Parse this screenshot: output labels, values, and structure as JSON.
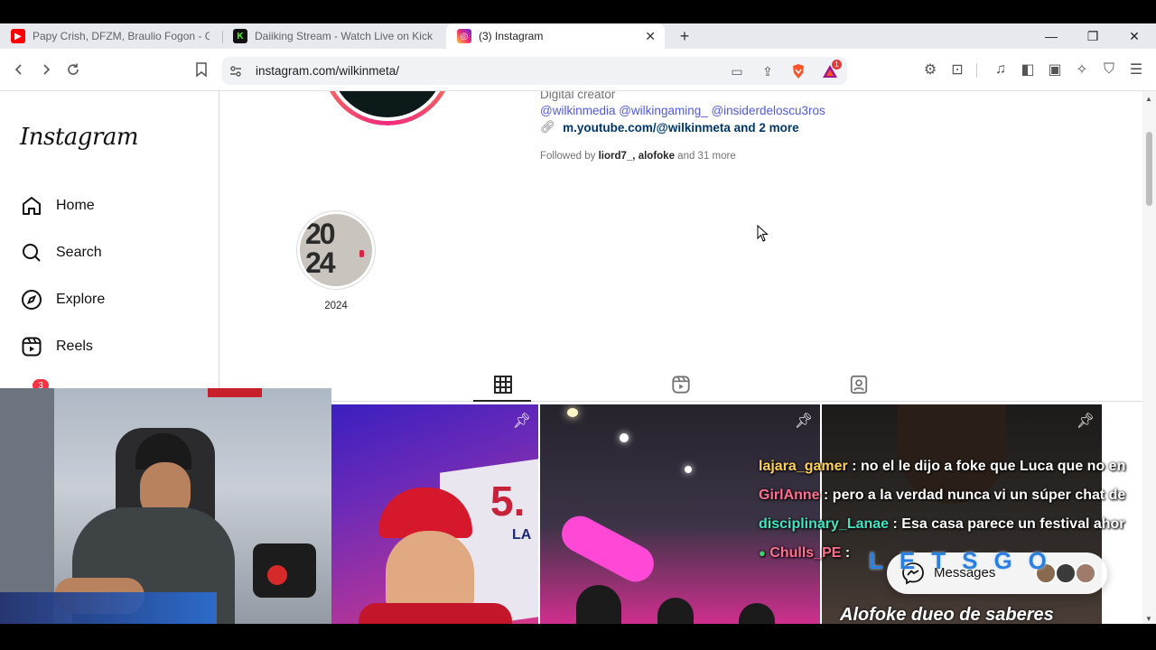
{
  "browser": {
    "tabs": [
      {
        "title": "Papy Crish, DFZM, Braulio Fogon - G",
        "icon": "youtube-icon",
        "color": "#ff0000"
      },
      {
        "title": "Daiiking Stream - Watch Live on Kick",
        "icon": "kick-icon",
        "color": "#53fc18"
      },
      {
        "title": "(3) Instagram",
        "icon": "instagram-icon",
        "color": "#e1306c",
        "active": true
      }
    ],
    "url": "instagram.com/wilkinmeta/",
    "brave_badge": "1"
  },
  "sidebar": {
    "logo": "Instagram",
    "items": [
      {
        "label": "Home",
        "icon": "home-icon"
      },
      {
        "label": "Search",
        "icon": "search-icon"
      },
      {
        "label": "Explore",
        "icon": "compass-icon"
      },
      {
        "label": "Reels",
        "icon": "reels-icon"
      }
    ],
    "notification_count": "3"
  },
  "profile": {
    "category": "Digital creator",
    "handles": "@wilkinmedia @wilkingaming_ @insiderdeloscu3ros",
    "link": "m.youtube.com/@wilkinmeta and 2 more",
    "followed_prefix": "Followed by",
    "followed_user1": "liord7_",
    "followed_sep": ",",
    "followed_user2": "alofoke",
    "followed_suffix": "and 31 more",
    "highlight_label": "2024",
    "highlight_text_top": "20",
    "highlight_text_bottom": "24"
  },
  "post_tabs": [
    "posts-grid-icon",
    "reels-tab-icon",
    "tagged-icon"
  ],
  "posts": [
    {
      "pinned": true,
      "overlay_number": "5.",
      "overlay_text": "LA"
    },
    {
      "pinned": true
    },
    {
      "pinned": true,
      "caption": "Alofoke dueo de saberes"
    }
  ],
  "chat": [
    {
      "user": "lajara_gamer",
      "color": "#ffd15a",
      "text": ": no el le dijo a foke que Luca que no en"
    },
    {
      "user": "GirlAnne",
      "color": "#ff6f8f",
      "text": ": pero a la verdad nunca vi un súper chat de"
    },
    {
      "user": "disciplinary_Lanae",
      "color": "#3ee6c2",
      "text": ": Esa casa parece un festival ahor"
    },
    {
      "user": "Chulls_PE",
      "color": "#ff6f8f",
      "text": ":"
    }
  ],
  "messages_label": "Messages",
  "emote_text": "LETSGO",
  "accent": "#0095f6"
}
